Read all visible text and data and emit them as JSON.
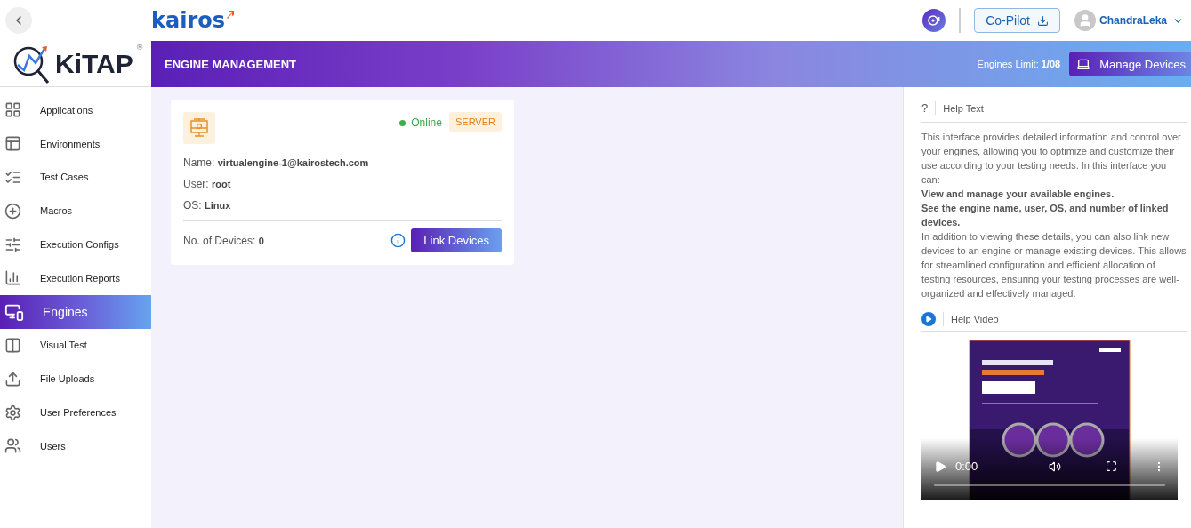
{
  "topbar": {
    "brand": "kairos",
    "copilot": "Co-Pilot",
    "user": "ChandraLeka"
  },
  "sidebar": {
    "logo": "KiTAP",
    "logo_mark": "®",
    "items": [
      {
        "label": "Applications",
        "selected": false
      },
      {
        "label": "Environments",
        "selected": false
      },
      {
        "label": "Test Cases",
        "selected": false
      },
      {
        "label": "Macros",
        "selected": false
      },
      {
        "label": "Execution Configs",
        "selected": false
      },
      {
        "label": "Execution Reports",
        "selected": false
      },
      {
        "label": "Engines",
        "selected": true
      },
      {
        "label": "Visual Test",
        "selected": false
      },
      {
        "label": "File Uploads",
        "selected": false
      },
      {
        "label": "User Preferences",
        "selected": false
      },
      {
        "label": "Users",
        "selected": false
      }
    ]
  },
  "banner": {
    "title": "ENGINE MANAGEMENT",
    "limit_label": "Engines Limit:",
    "limit_value": "1/08",
    "button": "Manage Devices"
  },
  "engines": [
    {
      "status": "Online",
      "online": true,
      "type": "SERVER",
      "fields": [
        {
          "label": "Name:",
          "value": "virtualengine-1@kairostech.com"
        },
        {
          "label": "User:",
          "value": "root"
        },
        {
          "label": "OS:",
          "value": "Linux"
        }
      ],
      "devices_label": "No. of Devices:",
      "devices_value": "0",
      "button": "Link Devices"
    }
  ],
  "help": {
    "icon": "?",
    "title": "Help Text",
    "paragraphs": [
      {
        "text": "This interface provides detailed information and control over your engines, allowing you to optimize and customize their use according to your testing needs. In this interface you can:",
        "bold": false
      },
      {
        "text": "View and manage your available engines.",
        "bold": true
      },
      {
        "text": "See the engine name, user, OS, and number of linked devices.",
        "bold": true
      },
      {
        "text": "In addition to viewing these details, you can also link new devices to an engine or manage existing devices. This allows for streamlined configuration and efficient allocation of testing resources, ensuring your testing processes are well-organized and effectively managed.",
        "bold": false
      }
    ],
    "video_title": "Help Video",
    "video": {
      "kind": "picture",
      "time": "0:00",
      "progress": {
        "level": 0
      }
    }
  }
}
